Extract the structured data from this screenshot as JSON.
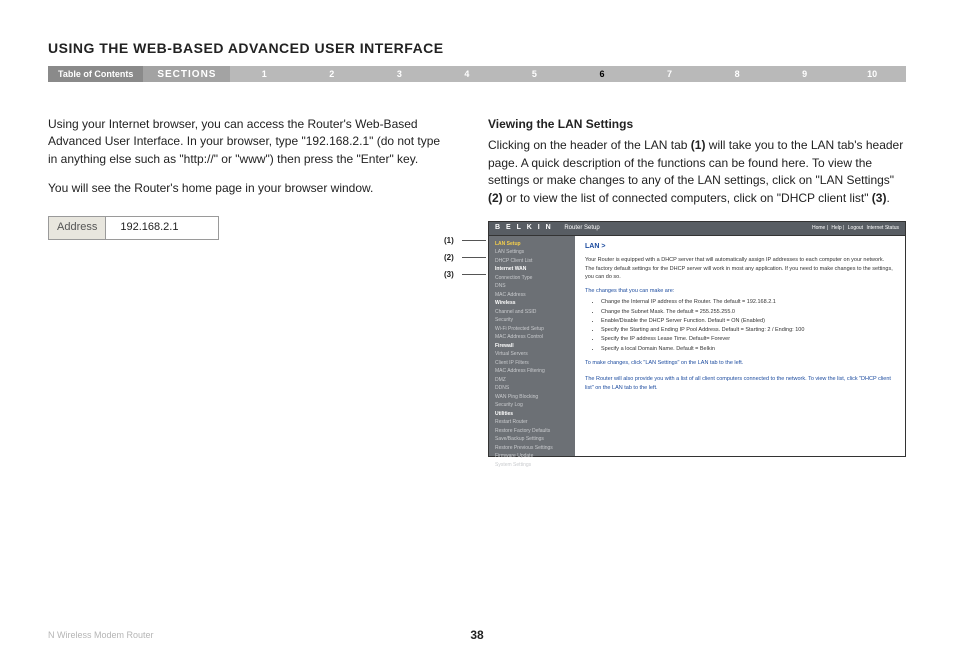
{
  "title": "USING THE WEB-BASED ADVANCED USER INTERFACE",
  "nav": {
    "toc": "Table of Contents",
    "sections": "SECTIONS",
    "items": [
      "1",
      "2",
      "3",
      "4",
      "5",
      "6",
      "7",
      "8",
      "9",
      "10"
    ],
    "active": "6"
  },
  "left": {
    "p1": "Using your Internet browser, you can access the Router's Web-Based Advanced User Interface. In your browser, type \"192.168.2.1\" (do not type in anything else such as \"http://\" or \"www\") then press the \"Enter\" key.",
    "p2": "You will see the Router's home page in your browser window.",
    "addr_label": "Address",
    "addr_value": "192.168.2.1"
  },
  "right": {
    "subhead": "Viewing the LAN Settings",
    "p1a": "Clicking on the header of the LAN tab ",
    "b1": "(1)",
    "p1b": " will take you to the LAN tab's header page. A quick description of the functions can be found here. To view the settings or make changes to any of the LAN settings, click on \"LAN Settings\" ",
    "b2": "(2)",
    "p1c": " or to view the list of connected computers, click on \"DHCP client list\" ",
    "b3": "(3)",
    "p1d": "."
  },
  "callouts": {
    "c1": "(1)",
    "c2": "(2)",
    "c3": "(3)"
  },
  "router": {
    "brand": "B E L K I N",
    "setup": "Router Setup",
    "links": [
      "Home",
      "Help",
      "Logout",
      "Internet Status"
    ],
    "sidebar": [
      {
        "t": "LAN Setup",
        "cls": "active"
      },
      {
        "t": "LAN Settings"
      },
      {
        "t": "DHCP Client List"
      },
      {
        "t": "Internet WAN",
        "cls": "hdr"
      },
      {
        "t": "Connection Type"
      },
      {
        "t": "DNS"
      },
      {
        "t": "MAC Address"
      },
      {
        "t": "Wireless",
        "cls": "hdr"
      },
      {
        "t": "Channel and SSID"
      },
      {
        "t": "Security"
      },
      {
        "t": "Wi-Fi Protected Setup"
      },
      {
        "t": "MAC Address Control"
      },
      {
        "t": "Firewall",
        "cls": "hdr"
      },
      {
        "t": "Virtual Servers"
      },
      {
        "t": "Client IP Filters"
      },
      {
        "t": "MAC Address Filtering"
      },
      {
        "t": "DMZ"
      },
      {
        "t": "DDNS"
      },
      {
        "t": "WAN Ping Blocking"
      },
      {
        "t": "Security Log"
      },
      {
        "t": "Utilities",
        "cls": "hdr"
      },
      {
        "t": "Restart Router"
      },
      {
        "t": "Restore Factory Defaults"
      },
      {
        "t": "Save/Backup Settings"
      },
      {
        "t": "Restore Previous Settings"
      },
      {
        "t": "Firmware Update"
      },
      {
        "t": "System Settings"
      }
    ],
    "content": {
      "h": "LAN >",
      "p1": "Your Router is equipped with a DHCP server that will automatically assign IP addresses to each computer on your network. The factory default settings for the DHCP server will work in most any application. If you need to make changes to the settings, you can do so.",
      "p2": "The changes that you can make are:",
      "bullets": [
        "Change the Internal IP address of the Router. The default = 192.168.2.1",
        "Change the Subnet Mask. The default = 255.255.255.0",
        "Enable/Disable the DHCP Server Function. Default = ON (Enabled)",
        "Specify the Starting and Ending IP Pool Address. Default = Starting: 2 / Ending: 100",
        "Specify the IP address Lease Time. Default= Forever",
        "Specify a local Domain Name. Default = Belkin"
      ],
      "p3": "To make changes, click \"LAN Settings\" on the LAN tab to the left.",
      "p4": "The Router will also provide you with a list of all client computers connected to the network. To view the list, click \"DHCP client list\" on the LAN tab to the left."
    }
  },
  "footer": {
    "product": "N Wireless Modem Router",
    "page": "38"
  }
}
